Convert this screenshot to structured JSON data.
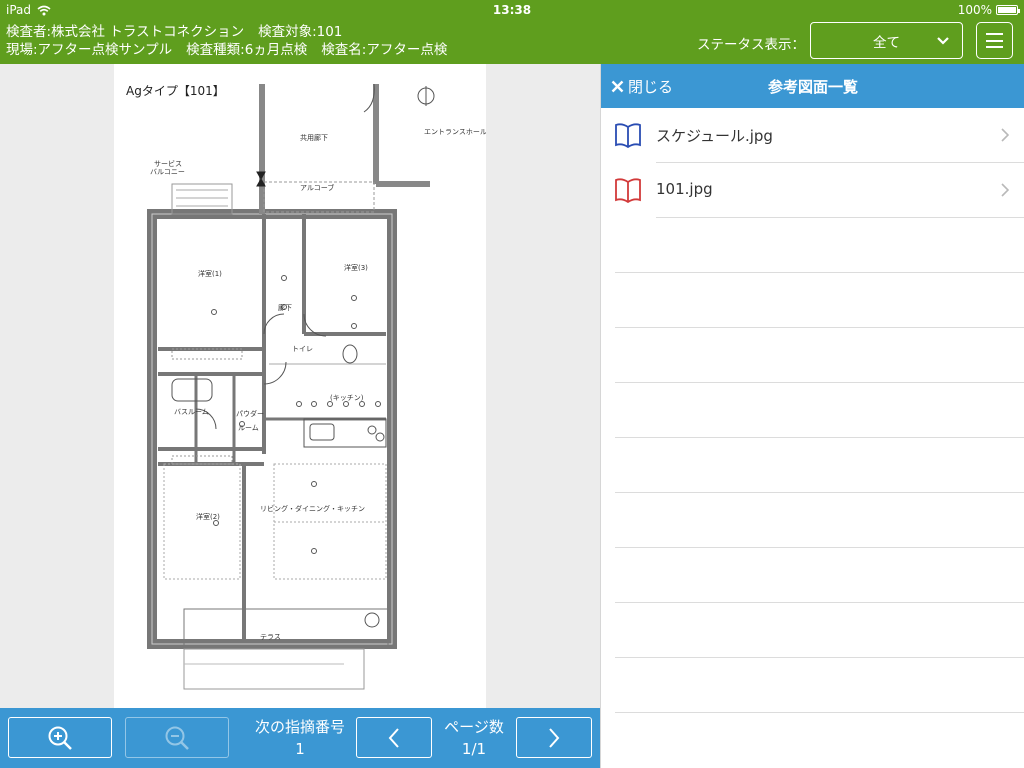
{
  "status_bar": {
    "device": "iPad",
    "time": "13:38",
    "battery": "100%"
  },
  "header": {
    "line1": [
      "検査者:株式会社 トラストコネクション",
      "検査対象:101"
    ],
    "line2": [
      "現場:アフター点検サンプル",
      "検査種類:6ヵ月点検",
      "検査名:アフター点検"
    ],
    "status_label": "ステータス表示：",
    "status_value": "全て"
  },
  "drawing": {
    "title": "Agタイプ【101】"
  },
  "toolbar": {
    "next_label": "次の指摘番号",
    "next_value": "1",
    "page_label": "ページ数",
    "page_value": "1/1"
  },
  "panel": {
    "close_label": "閉じる",
    "title": "参考図面一覧",
    "files": [
      {
        "name": "スケジュール.jpg",
        "icon": "book-icon",
        "color": "#2a4db3"
      },
      {
        "name": "101.jpg",
        "icon": "book-icon",
        "color": "#d23a3a"
      }
    ]
  },
  "colors": {
    "header_green": "#5f9e1e",
    "accent_blue": "#3b97d3"
  }
}
